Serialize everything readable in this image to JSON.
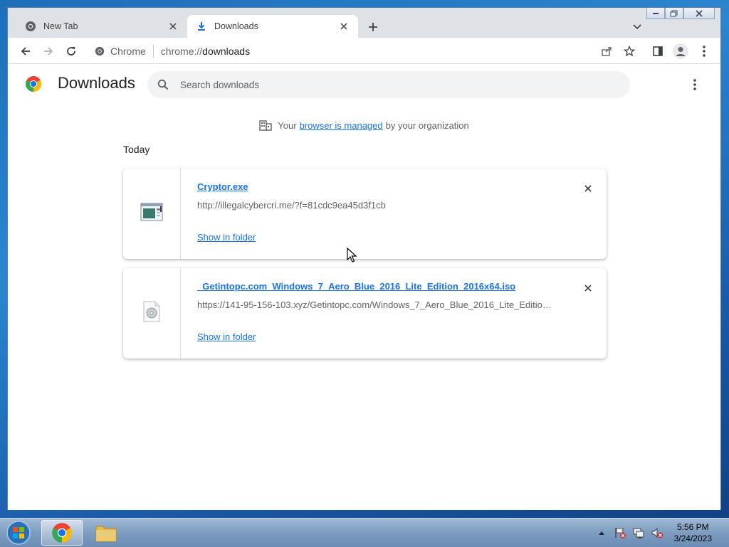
{
  "tabs": [
    {
      "title": "New Tab",
      "icon": "chrome-icon"
    },
    {
      "title": "Downloads",
      "icon": "download-icon"
    }
  ],
  "omnibox": {
    "chip_label": "Chrome",
    "url_scheme": "chrome://",
    "url_path": "downloads"
  },
  "page": {
    "title": "Downloads",
    "search_placeholder": "Search downloads",
    "managed": {
      "prefix": "Your",
      "link": "browser is managed",
      "suffix": "by your organization"
    },
    "date_label": "Today"
  },
  "downloads": [
    {
      "file_name": "Cryptor.exe",
      "url": "http://illegalcybercri.me/?f=81cdc9ea45d3f1cb",
      "action": "Show in folder",
      "icon": "exe-file-icon"
    },
    {
      "file_name": "_Getintopc.com_Windows_7_Aero_Blue_2016_Lite_Edition_2016x64.iso",
      "url": "https://141-95-156-103.xyz/Getintopc.com/Windows_7_Aero_Blue_2016_Lite_Edition...",
      "action": "Show in folder",
      "icon": "iso-file-icon"
    }
  ],
  "taskbar": {
    "time": "5:56 PM",
    "date": "3/24/2023"
  },
  "colors": {
    "link": "#1a73e8",
    "tabstrip": "#dee1e6"
  }
}
